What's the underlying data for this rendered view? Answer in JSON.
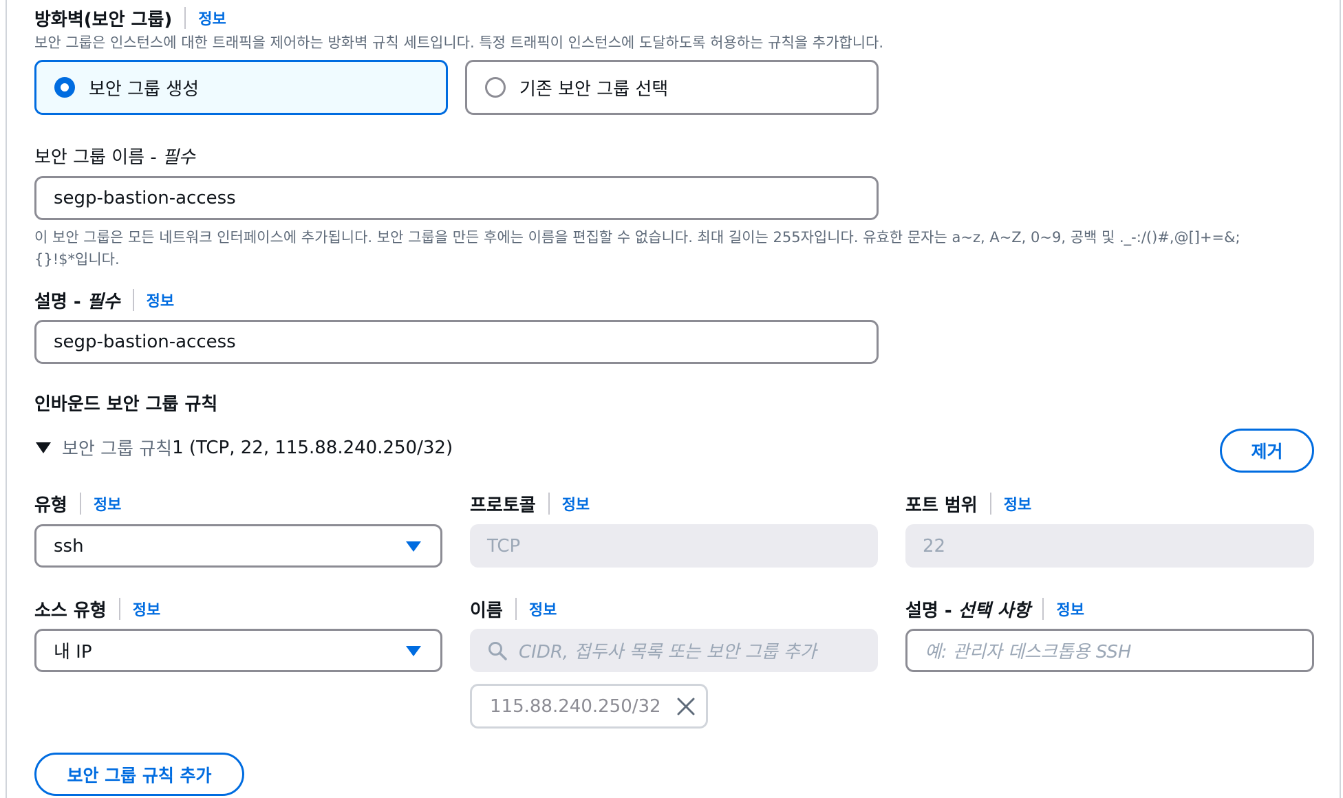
{
  "firewall": {
    "title": "방화벽(보안 그룹)",
    "info": "정보",
    "description": "보안 그룹은 인스턴스에 대한 트래픽을 제어하는 방화벽 규칙 세트입니다. 특정 트래픽이 인스턴스에 도달하도록 허용하는 규칙을 추가합니다.",
    "options": [
      {
        "label": "보안 그룹 생성",
        "selected": true
      },
      {
        "label": "기존 보안 그룹 선택",
        "selected": false
      }
    ]
  },
  "sg_name": {
    "label": "보안 그룹 이름 - ",
    "required": "필수",
    "value": "segp-bastion-access",
    "help_line1": "이 보안 그룹은 모든 네트워크 인터페이스에 추가됩니다. 보안 그룹을 만든 후에는 이름을 편집할 수 없습니다. 최대 길이는 255자입니다. 유효한 문자는 a~z, A~Z, 0~9, 공백 및 ._-:/()#,@[]+=&;",
    "help_line2": "{}!$*입니다."
  },
  "sg_desc": {
    "label": "설명 - ",
    "required": "필수",
    "info": "정보",
    "value": "segp-bastion-access"
  },
  "inbound": {
    "title": "인바운드 보안 그룹 규칙",
    "rule_prefix": "보안 그룹 규칙",
    "rule_detail": " 1 (TCP, 22, 115.88.240.250/32)",
    "remove_label": "제거",
    "type": {
      "label": "유형",
      "info": "정보",
      "value": "ssh"
    },
    "protocol": {
      "label": "프로토콜",
      "info": "정보",
      "value": "TCP"
    },
    "port": {
      "label": "포트 범위",
      "info": "정보",
      "value": "22"
    },
    "source_type": {
      "label": "소스 유형",
      "info": "정보",
      "value": "내 IP"
    },
    "name": {
      "label": "이름",
      "info": "정보",
      "placeholder": "CIDR, 접두사 목록 또는 보안 그룹 추가",
      "token": "115.88.240.250/32"
    },
    "rule_desc": {
      "label_prefix": "설명 - ",
      "label_italic": "선택 사항",
      "info": "정보",
      "placeholder": "예: 관리자 데스크톱용 SSH"
    },
    "add_rule_label": "보안 그룹 규칙 추가"
  },
  "colors": {
    "accent": "#006ce0",
    "selected_bg": "#f0fbff",
    "muted": "#5f6b7a",
    "border": "#8c8c94"
  }
}
